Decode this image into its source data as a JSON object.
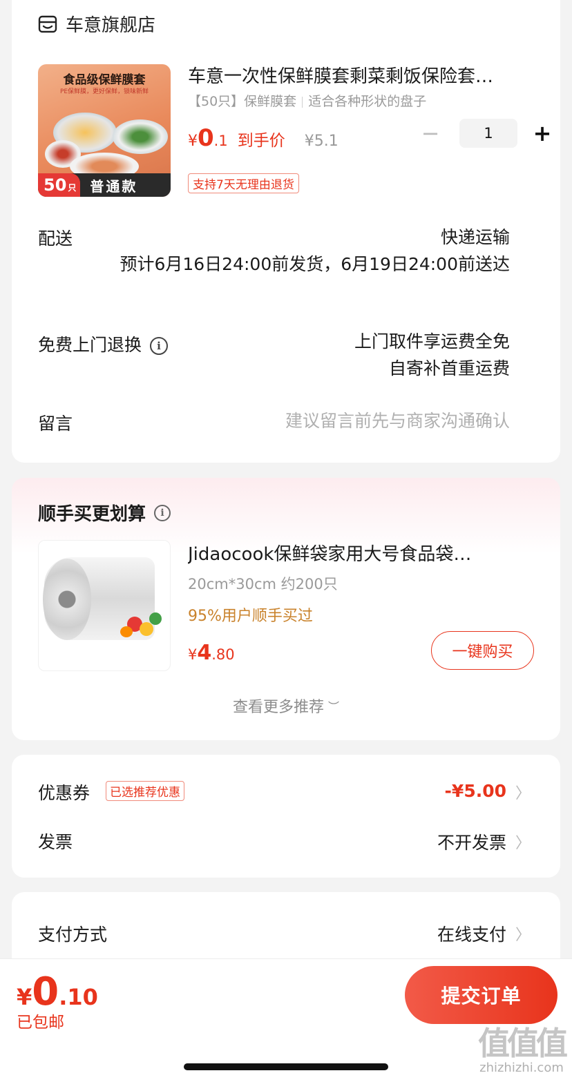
{
  "store": {
    "name": "车意旗舰店",
    "icon": "store-icon"
  },
  "product": {
    "image": {
      "title": "食品级保鲜膜套",
      "subtitle": "PE保鲜膜，更好保鲜，锁味新鲜",
      "count_num": "50",
      "count_unit": "只",
      "variant": "普通款"
    },
    "title": "车意一次性保鲜膜套剩菜剩饭保险套…",
    "spec_a": "【50只】保鲜膜套",
    "spec_b": "适合各种形状的盘子",
    "price_currency": "¥",
    "price_int": "0",
    "price_dec": ".1",
    "price_label": "到手价",
    "original_price": "¥5.1",
    "quantity": "1",
    "minus": "−",
    "plus": "+",
    "return_tag": "支持7天无理由退货"
  },
  "delivery": {
    "label": "配送",
    "method": "快递运输",
    "estimate": "预计6月16日24:00前发货，6月19日24:00前送达"
  },
  "free_return": {
    "label": "免费上门退换",
    "info_icon": "info-icon",
    "line1": "上门取件享运费全免",
    "line2": "自寄补首重运费"
  },
  "message": {
    "label": "留言",
    "placeholder": "建议留言前先与商家沟通确认"
  },
  "recommendation": {
    "title": "顺手买更划算",
    "item": {
      "name": "Jidaocook保鲜袋家用大号食品袋…",
      "spec": "20cm*30cm 约200只",
      "social": "95%用户顺手买过",
      "price_currency": "¥",
      "price_int": "4",
      "price_dec": ".80",
      "buy_label": "一键购买"
    },
    "more_label": "查看更多推荐",
    "more_icon": "chevron-down-icon"
  },
  "coupon": {
    "label": "优惠券",
    "tag": "已选推荐优惠",
    "value": "-¥5.00"
  },
  "invoice": {
    "label": "发票",
    "value": "不开发票"
  },
  "payment": {
    "label": "支付方式",
    "value": "在线支付"
  },
  "arrow": "〉",
  "bottom": {
    "total_currency": "¥",
    "total_int": "0",
    "total_dec": ".10",
    "shipping": "已包邮",
    "submit_label": "提交订单"
  },
  "watermark": {
    "logo": "值值值",
    "url": "zhizhizhi.com"
  },
  "colors": {
    "accent": "#e8341c",
    "muted": "#9a9a9a",
    "social": "#c9822b",
    "background": "#f3f3f3"
  }
}
